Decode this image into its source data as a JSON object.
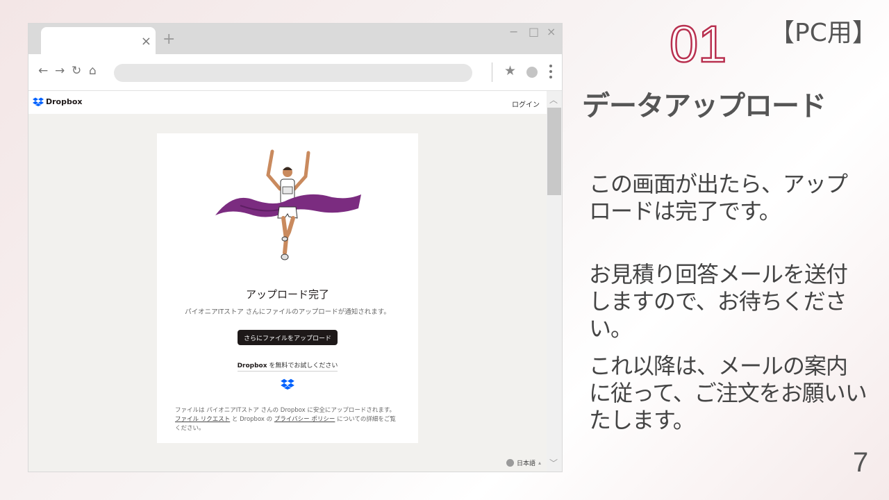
{
  "browser": {
    "tab_close": "×",
    "new_tab": "+",
    "window_controls": {
      "minimize": "−",
      "maximize": "□",
      "close": "×"
    },
    "nav": {
      "back": "←",
      "forward": "→",
      "reload": "↻",
      "home": "⌂"
    },
    "star": "★",
    "icons": [
      "back-arrow-icon",
      "forward-arrow-icon",
      "reload-icon",
      "home-icon",
      "star-icon",
      "profile-icon",
      "kebab-menu-icon",
      "globe-icon",
      "chevron-up-icon",
      "chevron-down-icon"
    ]
  },
  "site": {
    "brand": "Dropbox",
    "login": "ログイン",
    "brand_color": "#0061fe"
  },
  "card": {
    "title": "アップロード完了",
    "subtitle": "パイオニアITストア さんにファイルのアップロードが通知されます。",
    "upload_more_button": "さらにファイルをアップロード",
    "try_brand": "Dropbox",
    "try_text": " を無料でお試しください",
    "footnote": {
      "part1": "ファイルは パイオニアITストア さんの Dropbox に安全にアップロードされます。",
      "link1": "ファイル リクエスト",
      "part2": "と Dropbox の",
      "link2": "プライバシー ポリシー",
      "part3": "についての詳細をご覧ください。"
    }
  },
  "language": {
    "label": "日本語",
    "caret": "▴"
  },
  "slide": {
    "badge": "【PC用】",
    "step_number": "01",
    "title": "データアップロード",
    "para1": "この画面が出たら、アップロードは完了です。",
    "para2": "お見積り回答メールを送付しますので、お待ちください。",
    "para3": "これ以降は、メールの案内に従って、ご注文をお願いいたします。",
    "page_number": "7",
    "accent_color": "#b8304f"
  }
}
